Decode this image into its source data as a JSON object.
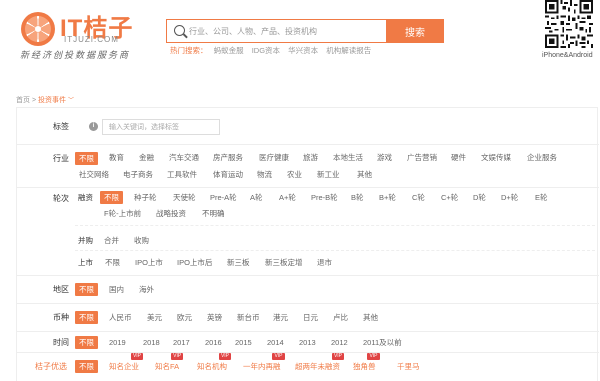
{
  "logo": {
    "title": "IT桔子",
    "domain": "ITJUZI.COM",
    "slogan": "新经济创投数据服务商"
  },
  "search": {
    "placeholder": "行业、公司、人物、产品、投资机构",
    "button_label": "搜索",
    "hot_label": "热门搜索：",
    "hot_items": [
      "蚂蚁金服",
      "IDG资本",
      "华兴资本",
      "机构解读报告"
    ]
  },
  "qr": {
    "caption": "iPhone&Android"
  },
  "breadcrumb": {
    "home": "首页",
    "separator": ">",
    "current": "投资事件"
  },
  "filters": {
    "tags": {
      "label": "标签",
      "placeholder": "输入关键词，选择标签"
    },
    "industry": {
      "label": "行业",
      "options": [
        "不限",
        "教育",
        "金融",
        "汽车交通",
        "房产服务",
        "医疗健康",
        "旅游",
        "本地生活",
        "游戏",
        "广告营销",
        "硬件",
        "文娱传媒",
        "企业服务",
        "社交网络",
        "电子商务",
        "工具软件",
        "体育运动",
        "物流",
        "农业",
        "新工业",
        "其他"
      ]
    },
    "round": {
      "label": "轮次",
      "financing_label": "融资",
      "financing_options": [
        "不限",
        "种子轮",
        "天使轮",
        "Pre-A轮",
        "A轮",
        "A+轮",
        "Pre-B轮",
        "B轮",
        "B+轮",
        "C轮",
        "C+轮",
        "D轮",
        "D+轮",
        "E轮",
        "F轮-上市前",
        "战略投资",
        "不明确"
      ],
      "merger_label": "并购",
      "merger_options": [
        "合并",
        "收购"
      ],
      "ipo_label": "上市",
      "ipo_options": [
        "不限",
        "IPO上市",
        "IPO上市后",
        "新三板",
        "新三板定增",
        "退市"
      ]
    },
    "region": {
      "label": "地区",
      "options": [
        "不限",
        "国内",
        "海外"
      ]
    },
    "currency": {
      "label": "币种",
      "options": [
        "不限",
        "人民币",
        "美元",
        "欧元",
        "英镑",
        "新台币",
        "港元",
        "日元",
        "卢比",
        "其他"
      ]
    },
    "time": {
      "label": "时间",
      "options": [
        "不限",
        "2019",
        "2018",
        "2017",
        "2016",
        "2015",
        "2014",
        "2013",
        "2012",
        "2011及以前"
      ]
    },
    "premium": {
      "label": "桔子优选",
      "options": [
        "不限",
        "知名企业",
        "知名FA",
        "知名机构",
        "一年内再融",
        "超两年未融资",
        "独角兽",
        "千里马"
      ],
      "badge": "VIP"
    }
  },
  "colors": {
    "accent": "#f07a45",
    "vip": "#e04444"
  }
}
